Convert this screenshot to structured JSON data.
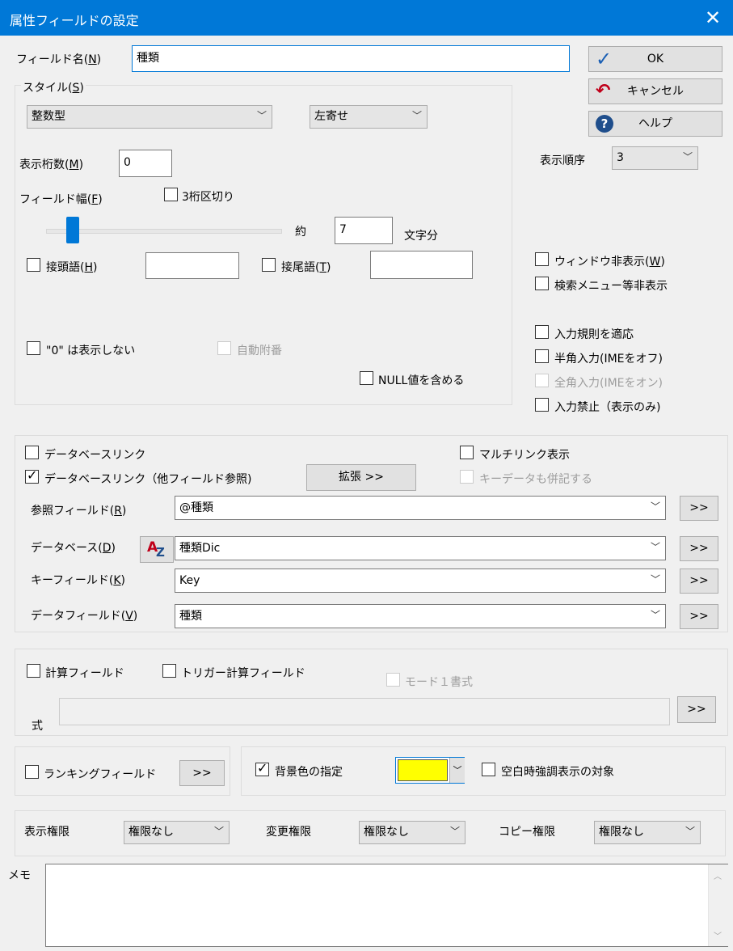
{
  "window": {
    "title": "属性フィールドの設定",
    "close_glyph": "✕"
  },
  "field_name": {
    "label": "フィールド名(",
    "key": "N",
    "label_end": ")",
    "value": "種類"
  },
  "buttons": {
    "ok": "OK",
    "cancel": "キャンセル",
    "help": "ヘルプ"
  },
  "style": {
    "label": "スタイル(",
    "key": "S",
    "label_end": ")",
    "type_value": "整数型",
    "align_value": "左寄せ",
    "digits_label": "表示桁数(",
    "digits_key": "M",
    "digits_label_end": ")",
    "digits_value": "0",
    "width_label": "フィールド幅(",
    "width_key": "F",
    "width_label_end": ")",
    "sep3_label": "3桁区切り",
    "approx_label": "約",
    "chars_value": "7",
    "chars_unit": "文字分",
    "slider_fraction": 0.09,
    "prefix_label": "接頭語(",
    "prefix_key": "H",
    "prefix_end": ")",
    "suffix_label": "接尾語(",
    "suffix_key": "T",
    "suffix_end": ")",
    "hide_zero_label": "\"0\" は表示しない",
    "autonum_label": "自動附番",
    "null_label": "NULL値を含める"
  },
  "order": {
    "label": "表示順序",
    "value": "3"
  },
  "window_opts": {
    "hide_window": "ウィンドウ非表示(",
    "hide_window_key": "W",
    "hide_window_end": ")",
    "hide_search": "検索メニュー等非表示",
    "input_rule": "入力規則を適応",
    "halfwidth": "半角入力(IMEをオフ)",
    "fullwidth": "全角入力(IMEをオン)",
    "no_input": "入力禁止（表示のみ)"
  },
  "db_link": {
    "link_label": "データベースリンク",
    "link_other_label": "データベースリンク（他フィールド参照)",
    "expand_label": "拡張 >>",
    "multi_label": "マルチリンク表示",
    "keydata_label": "キーデータも併記する",
    "ref_label": "参照フィールド(",
    "ref_key": "R",
    "ref_end": ")",
    "ref_value": "@種類",
    "db_label": "データベース(",
    "db_key": "D",
    "db_end": ")",
    "db_value": "種類Dic",
    "key_label": "キーフィールド(",
    "key_key": "K",
    "key_end": ")",
    "key_value": "Key",
    "data_label": "データフィールド(",
    "data_key": "V",
    "data_end": ")",
    "data_value": "種類",
    "more": ">>"
  },
  "calc": {
    "calc_label": "計算フィールド",
    "trigger_label": "トリガー計算フィールド",
    "mode_label": "モード１書式",
    "expr_label": "式",
    "expr_value": "",
    "more": ">>"
  },
  "ranking": {
    "label": "ランキングフィールド",
    "more": ">>"
  },
  "bg": {
    "label": "背景色の指定",
    "color": "#ffff00",
    "blank_label": "空白時強調表示の対象"
  },
  "perm": {
    "view_label": "表示権限",
    "view_value": "権限なし",
    "edit_label": "変更権限",
    "edit_value": "権限なし",
    "copy_label": "コピー権限",
    "copy_value": "権限なし"
  },
  "memo": {
    "label": "メモ",
    "value": ""
  }
}
